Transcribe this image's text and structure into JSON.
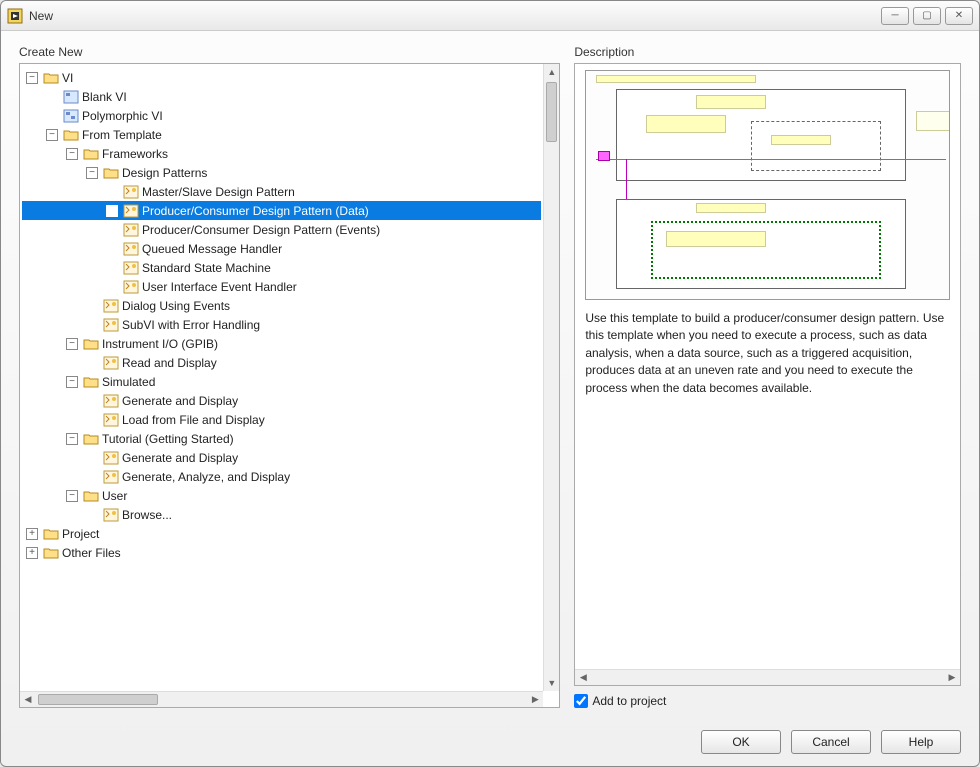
{
  "window": {
    "title": "New"
  },
  "panels": {
    "left_label": "Create New",
    "right_label": "Description"
  },
  "tree": {
    "root": "VI",
    "blank_vi": "Blank VI",
    "polymorphic_vi": "Polymorphic VI",
    "from_template": "From Template",
    "frameworks": "Frameworks",
    "design_patterns": "Design Patterns",
    "dp_master_slave": "Master/Slave Design Pattern",
    "dp_producer_consumer_data": "Producer/Consumer Design Pattern (Data)",
    "dp_producer_consumer_events": "Producer/Consumer Design Pattern (Events)",
    "dp_queued_msg": "Queued Message Handler",
    "dp_std_state": "Standard State Machine",
    "dp_ui_event": "User Interface Event Handler",
    "dialog_events": "Dialog Using Events",
    "subvi_error": "SubVI with Error Handling",
    "instrument_io": "Instrument I/O (GPIB)",
    "read_display": "Read and Display",
    "simulated": "Simulated",
    "gen_display": "Generate and Display",
    "load_file": "Load from File and Display",
    "tutorial": "Tutorial (Getting Started)",
    "tut_gen": "Generate and Display",
    "tut_gen_analyze": "Generate, Analyze, and Display",
    "user": "User",
    "browse": "Browse...",
    "project": "Project",
    "other_files": "Other Files"
  },
  "description": {
    "text": "Use this template to build a producer/consumer design pattern. Use this template when you need to execute a process, such as data analysis, when a data source, such as a triggered acquisition, produces data at an uneven rate and you need to execute the process when the data becomes available."
  },
  "checkbox": {
    "label": "Add to project",
    "checked": true
  },
  "buttons": {
    "ok": "OK",
    "cancel": "Cancel",
    "help": "Help"
  }
}
